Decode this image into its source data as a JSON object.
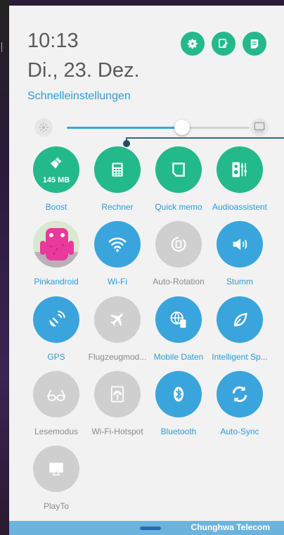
{
  "header": {
    "time": "10:13",
    "date": "Di., 23. Dez.",
    "quick_settings_title": "Schnelleinstellungen"
  },
  "top_icons": [
    "settings-icon",
    "edit-icon",
    "notes-icon"
  ],
  "brightness": {
    "level_fraction": 0.63,
    "auto_label": "AUTO"
  },
  "tiles": [
    {
      "label": "Boost",
      "state": "on",
      "icon": "broom-icon",
      "badge": "145 MB"
    },
    {
      "label": "Rechner",
      "state": "on",
      "icon": "calculator-icon"
    },
    {
      "label": "Quick memo",
      "state": "on",
      "icon": "memo-icon"
    },
    {
      "label": "Audioassistent",
      "state": "on",
      "icon": "audio-mixer-icon"
    },
    {
      "label": "Pinkandroid",
      "state": "photo",
      "icon": "pink-android-avatar"
    },
    {
      "label": "Wi-Fi",
      "state": "blue",
      "icon": "wifi-icon"
    },
    {
      "label": "Auto-Rotation",
      "state": "off",
      "icon": "rotation-icon"
    },
    {
      "label": "Stumm",
      "state": "blue",
      "icon": "vibrate-icon"
    },
    {
      "label": "GPS",
      "state": "blue",
      "icon": "gps-icon"
    },
    {
      "label": "Flugzeugmod...",
      "state": "off",
      "icon": "airplane-icon"
    },
    {
      "label": "Mobile Daten",
      "state": "blue",
      "icon": "mobile-data-icon"
    },
    {
      "label": "Intelligent Sp...",
      "state": "blue",
      "icon": "leaf-icon"
    },
    {
      "label": "Lesemodus",
      "state": "off",
      "icon": "glasses-icon"
    },
    {
      "label": "Wi-Fi-Hotspot",
      "state": "off",
      "icon": "hotspot-icon"
    },
    {
      "label": "Bluetooth",
      "state": "blue",
      "icon": "bluetooth-icon"
    },
    {
      "label": "Auto-Sync",
      "state": "blue",
      "icon": "sync-icon"
    },
    {
      "label": "PlayTo",
      "state": "off",
      "icon": "playto-icon"
    }
  ],
  "footer": {
    "carrier": "Chunghwa Telecom"
  },
  "colors": {
    "green": "#23b98b",
    "blue": "#3aa5dc",
    "off": "#cfcfcf",
    "accent_text": "#2e9bd6"
  }
}
